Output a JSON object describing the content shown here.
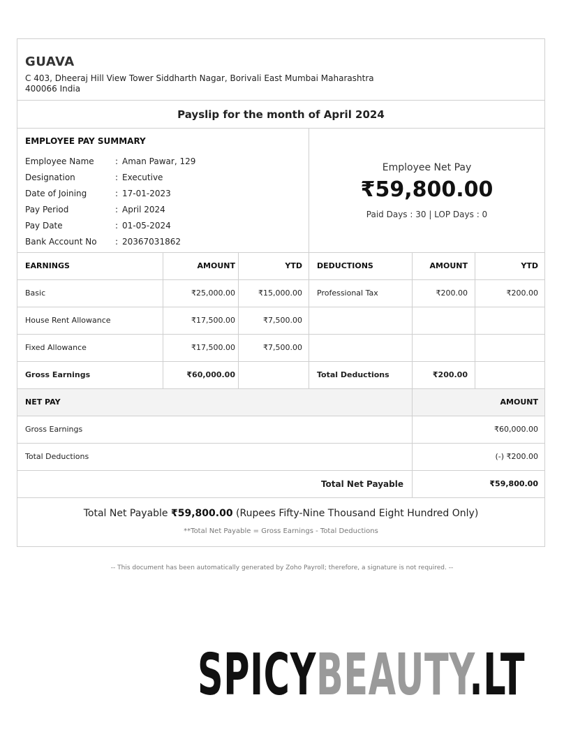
{
  "company": {
    "name": "GUAVA",
    "address": "C 403, Dheeraj Hill View Tower Siddharth Nagar, Borivali East Mumbai Maharashtra 400066 India"
  },
  "title": "Payslip for the month of April 2024",
  "summary": {
    "heading": "EMPLOYEE PAY SUMMARY",
    "fields": [
      {
        "label": "Employee Name",
        "value": "Aman Pawar, 129"
      },
      {
        "label": "Designation",
        "value": "Executive"
      },
      {
        "label": "Date of Joining",
        "value": "17-01-2023"
      },
      {
        "label": "Pay Period",
        "value": "April 2024"
      },
      {
        "label": "Pay Date",
        "value": "01-05-2024"
      },
      {
        "label": "Bank Account No",
        "value": "20367031862"
      }
    ],
    "net_pay_label": "Employee Net Pay",
    "net_pay_amount": "₹59,800.00",
    "days_text": "Paid Days : 30 | LOP Days : 0"
  },
  "earnings_table": {
    "headers": [
      "EARNINGS",
      "AMOUNT",
      "YTD",
      "DEDUCTIONS",
      "AMOUNT",
      "YTD"
    ],
    "rows": [
      [
        "Basic",
        "₹25,000.00",
        "₹15,000.00",
        "Professional Tax",
        "₹200.00",
        "₹200.00"
      ],
      [
        "House Rent Allowance",
        "₹17,500.00",
        "₹7,500.00",
        "",
        "",
        ""
      ],
      [
        "Fixed Allowance",
        "₹17,500.00",
        "₹7,500.00",
        "",
        "",
        ""
      ]
    ],
    "totals": [
      "Gross Earnings",
      "₹60,000.00",
      "",
      "Total Deductions",
      "₹200.00",
      ""
    ]
  },
  "net_pay_table": {
    "header_label": "NET PAY",
    "header_amount": "AMOUNT",
    "rows": [
      {
        "label": "Gross Earnings",
        "amount": "₹60,000.00"
      },
      {
        "label": "Total Deductions",
        "amount": "(-) ₹200.00"
      }
    ],
    "total_label": "Total Net Payable",
    "total_amount": "₹59,800.00"
  },
  "words": {
    "prefix": "Total Net Payable",
    "amount": "₹59,800.00",
    "in_words": "(Rupees Fifty-Nine Thousand Eight Hundred Only)",
    "formula": "**Total Net Payable = Gross Earnings - Total Deductions"
  },
  "disclaimer": "-- This document has been automatically generated by Zoho Payroll; therefore, a signature is not required. --",
  "watermark": {
    "part1": "SPICY",
    "part2": "BEAUTY",
    "part3": ".LT"
  }
}
